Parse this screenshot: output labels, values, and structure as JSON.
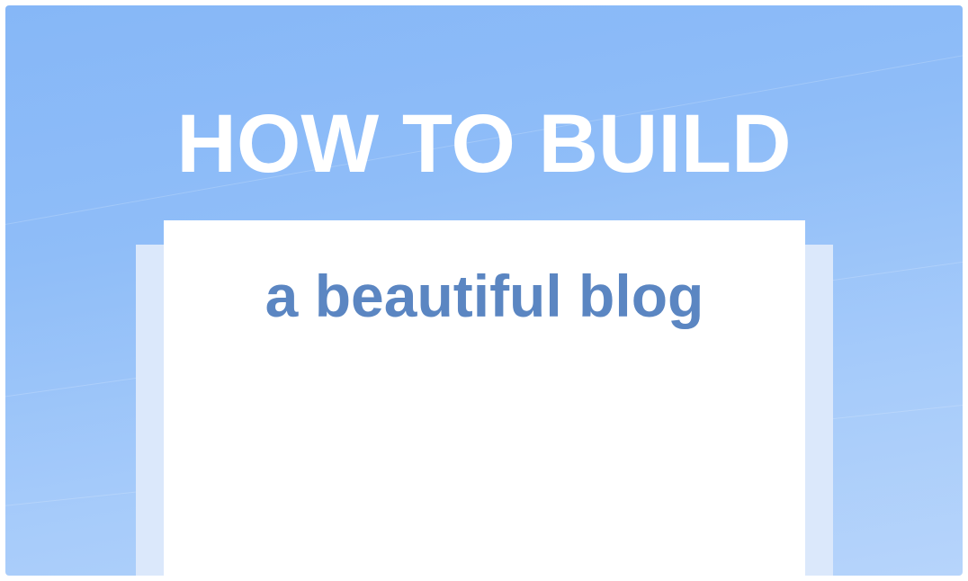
{
  "hero": {
    "headline": "HOW TO BUILD",
    "subheadline": "a beautiful blog"
  },
  "colors": {
    "background_top": "#86b7f7",
    "background_bottom": "#b6d4fb",
    "headline": "#ffffff",
    "subheadline": "#5b86c2",
    "panel_front": "#ffffff",
    "panel_back": "#dbe8fb"
  }
}
